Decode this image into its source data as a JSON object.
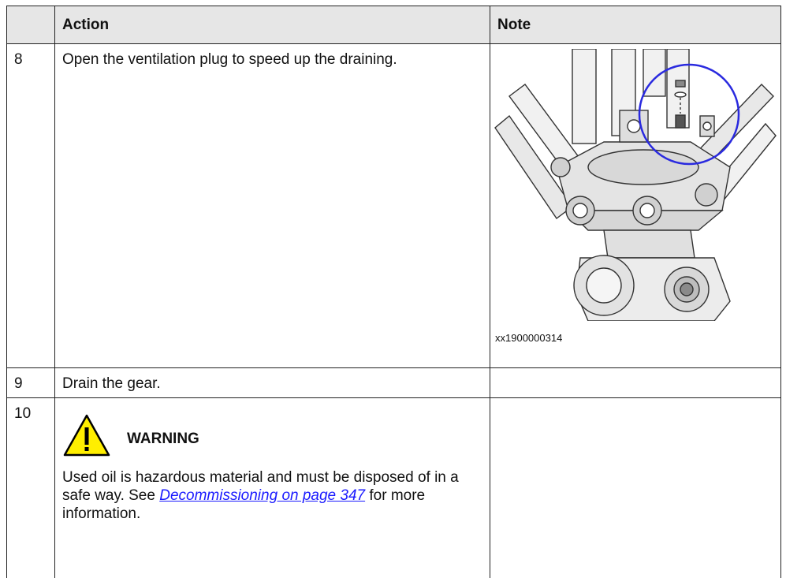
{
  "header": {
    "col_step": "",
    "col_action": "Action",
    "col_note": "Note"
  },
  "rows": [
    {
      "step": "8",
      "action": "Open the ventilation plug to speed up the draining.",
      "figure_id": "xx1900000314",
      "figure_highlight_color": "#2a2adf"
    },
    {
      "step": "9",
      "action": "Drain the gear.",
      "note": ""
    },
    {
      "step": "10",
      "warning_title": "WARNING",
      "warning_icon": "warning-triangle-icon",
      "warning_icon_color": "#ffee00",
      "warning_text_before": "Used oil is hazardous material and must be disposed of in a safe way. See ",
      "warning_link": "Decommissioning on page 347",
      "warning_text_after": " for more information.",
      "link_color": "#1a1aff"
    }
  ]
}
